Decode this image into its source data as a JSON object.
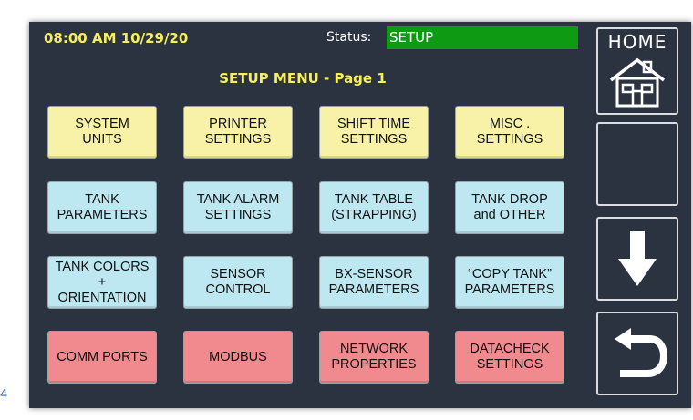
{
  "header": {
    "datetime": "08:00 AM 10/29/20",
    "status_label": "Status:",
    "status_value": "SETUP",
    "status_color": "#0f9a13"
  },
  "menu": {
    "title": "SETUP MENU - Page 1",
    "buttons": [
      {
        "label": "SYSTEM\nUNITS",
        "color": "yellow"
      },
      {
        "label": "PRINTER\nSETTINGS",
        "color": "yellow"
      },
      {
        "label": "SHIFT TIME\nSETTINGS",
        "color": "yellow"
      },
      {
        "label": "MISC .\nSETTINGS",
        "color": "yellow"
      },
      {
        "label": "TANK\nPARAMETERS",
        "color": "cyan"
      },
      {
        "label": "TANK ALARM\nSETTINGS",
        "color": "cyan"
      },
      {
        "label": "TANK TABLE\n(STRAPPING)",
        "color": "cyan"
      },
      {
        "label": "TANK DROP\nand OTHER",
        "color": "cyan"
      },
      {
        "label": "TANK COLORS\n+\nORIENTATION",
        "color": "cyan"
      },
      {
        "label": "SENSOR\nCONTROL",
        "color": "cyan"
      },
      {
        "label": "BX-SENSOR\nPARAMETERS",
        "color": "cyan"
      },
      {
        "label": "“COPY TANK”\nPARAMETERS",
        "color": "cyan"
      },
      {
        "label": "COMM PORTS",
        "color": "red"
      },
      {
        "label": "MODBUS",
        "color": "red"
      },
      {
        "label": "NETWORK\nPROPERTIES",
        "color": "red"
      },
      {
        "label": "DATACHECK\nSETTINGS",
        "color": "red"
      }
    ]
  },
  "sidebar": {
    "home_label": "HOME",
    "icons": [
      "house-icon",
      "blank",
      "arrow-down-icon",
      "return-arrow-icon"
    ]
  },
  "colors": {
    "panel_bg": "#2c3340",
    "title_yellow": "#f6ee5a",
    "button_yellow": "#f8f2a8",
    "button_cyan": "#bde8f2",
    "button_red": "#f08a8e"
  },
  "edge_text": "4"
}
